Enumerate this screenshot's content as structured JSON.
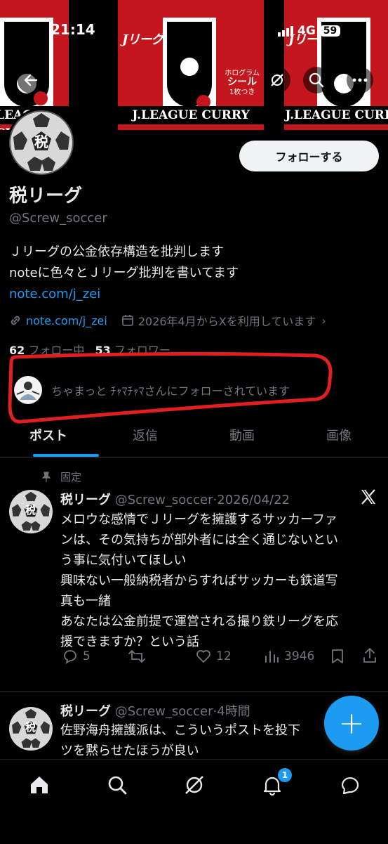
{
  "status_bar": {
    "time": "21:14",
    "network": "4G",
    "battery": "59"
  },
  "banner": {
    "brand": "Jリーグカレー",
    "hologram": [
      "ホログラム",
      "シール",
      "1枚つき"
    ],
    "title": "J.LEAGUE CURRY"
  },
  "profile": {
    "avatar_glyph": "税",
    "name": "税リーグ",
    "handle": "@Screw_soccer",
    "bio_line1": "Ｊリーグの公金依存構造を批判します",
    "bio_line2": "noteに色々とＪリーグ批判を書いてます",
    "bio_link": "note.com/j_zei",
    "meta_link": "note.com/j_zei",
    "joined": "2026年4月からXを利用しています",
    "following_count": "62",
    "following_label": "フォロー中",
    "followers_count": "53",
    "followers_label": "フォロワー",
    "followed_by": "ちゃまっと ﾁｬﾏﾁｬﾏさんにフォローされています",
    "follow_button": "フォローする"
  },
  "tabs": [
    {
      "label": "ポスト",
      "active": true
    },
    {
      "label": "返信",
      "active": false
    },
    {
      "label": "動画",
      "active": false
    },
    {
      "label": "画像",
      "active": false
    }
  ],
  "pinned_label": "固定",
  "tweets": [
    {
      "name": "税リーグ",
      "handle": "@Screw_soccer",
      "sep": "·",
      "time": "2026/04/22",
      "lines": [
        "メロウな感情でＪリーグを擁護するサッカーファ",
        "ンは、その気持ちが部外者には全く通じないとい",
        "う事に気付いてほしい",
        "興味ない一般納税者からすればサッカーも鉄道写",
        "真も一緒",
        "あなたは公金前提で運営される撮り鉄リーグを応",
        "援できますか？という話"
      ],
      "replies": "5",
      "retweets": "",
      "likes": "12",
      "views": "3946"
    },
    {
      "name": "税リーグ",
      "handle": "@Screw_soccer",
      "sep": "·",
      "time": "4時間",
      "lines": [
        "佐野海舟擁護派は、こういうポストを投下",
        "ツを黙らせたほうが良い"
      ]
    }
  ],
  "fab_label": "+",
  "bottom_nav": {
    "notif_badge": "1"
  },
  "colors": {
    "accent": "#1d9bf0",
    "annotation": "#e02020",
    "banner_red": "#c4161c"
  }
}
